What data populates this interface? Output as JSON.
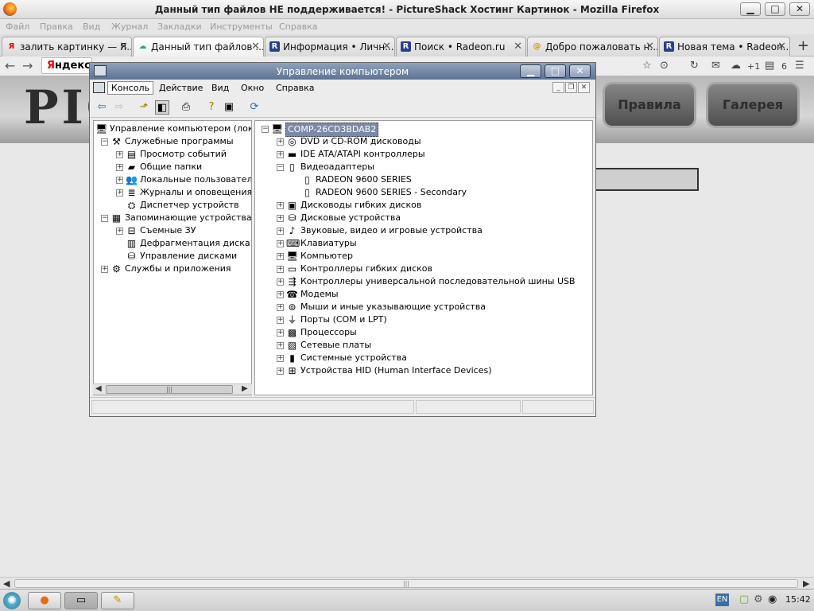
{
  "firefox": {
    "title": "Данный тип файлов НЕ поддерживается! - PictureShack Хостинг Картинок - Mozilla Firefox",
    "window_buttons": {
      "minimize": "▁",
      "maximize": "□",
      "close": "✕"
    },
    "menu": [
      "Файл",
      "Правка",
      "Вид",
      "Журнал",
      "Закладки",
      "Инструменты",
      "Справка"
    ],
    "tabs": [
      {
        "label": "залить картинку — Я...",
        "icon": "yandex-icon",
        "close": "✕"
      },
      {
        "label": "Данный тип файлов ...",
        "icon": "pictureshack-icon",
        "close": "✕",
        "active": true
      },
      {
        "label": "Информация • Личн...",
        "icon": "radeon-icon",
        "close": "✕"
      },
      {
        "label": "Поиск • Radeon.ru",
        "icon": "radeon-icon",
        "close": "✕"
      },
      {
        "label": "Добро пожаловать н...",
        "icon": "mail-icon",
        "close": "✕"
      },
      {
        "label": "Новая тема • Radeon....",
        "icon": "radeon-icon",
        "close": "✕"
      }
    ],
    "new_tab": "+",
    "nav": {
      "back": "←",
      "forward": "→",
      "yandex_y": "Я",
      "yandex_rest": "ндекс",
      "plus_one": "+1",
      "count": "6"
    }
  },
  "site": {
    "logo_text": "PIC",
    "buttons": [
      "Правила",
      "Галерея"
    ]
  },
  "mmc": {
    "title": "Управление компьютером",
    "window_buttons": {
      "minimize": "▁",
      "maximize": "□",
      "close": "✕"
    },
    "menu": [
      "Консоль",
      "Действие",
      "Вид",
      "Окно",
      "Справка"
    ],
    "inner_buttons": {
      "minimize": "_",
      "restore": "❐",
      "close": "✕"
    },
    "toolbar": [
      "back-icon",
      "forward-icon",
      "up-icon",
      "show-tree-icon",
      "print-icon",
      "help-icon",
      "properties-icon",
      "scan-icon"
    ],
    "tree": [
      {
        "label": "Управление компьютером (лока",
        "level": 0,
        "expander": "",
        "icon": "computer-icon"
      },
      {
        "label": "Служебные программы",
        "level": 1,
        "expander": "−",
        "icon": "tools-icon"
      },
      {
        "label": "Просмотр событий",
        "level": 2,
        "expander": "+",
        "icon": "event-icon"
      },
      {
        "label": "Общие папки",
        "level": 2,
        "expander": "+",
        "icon": "folder-icon"
      },
      {
        "label": "Локальные пользователи",
        "level": 2,
        "expander": "+",
        "icon": "users-icon"
      },
      {
        "label": "Журналы и оповещения",
        "level": 2,
        "expander": "+",
        "icon": "log-icon"
      },
      {
        "label": "Диспетчер устройств",
        "level": 2,
        "expander": "",
        "icon": "device-manager-icon"
      },
      {
        "label": "Запоминающие устройства",
        "level": 1,
        "expander": "−",
        "icon": "storage-icon"
      },
      {
        "label": "Съемные ЗУ",
        "level": 2,
        "expander": "+",
        "icon": "removable-icon"
      },
      {
        "label": "Дефрагментация диска",
        "level": 2,
        "expander": "",
        "icon": "defrag-icon"
      },
      {
        "label": "Управление дисками",
        "level": 2,
        "expander": "",
        "icon": "disk-icon"
      },
      {
        "label": "Службы и приложения",
        "level": 1,
        "expander": "+",
        "icon": "services-icon"
      }
    ],
    "devices": [
      {
        "label": "COMP-26CD3BDAB2",
        "level": 0,
        "expander": "−",
        "icon": "computer-icon",
        "selected": true
      },
      {
        "label": "DVD и CD-ROM дисководы",
        "level": 1,
        "expander": "+",
        "icon": "cdrom-icon"
      },
      {
        "label": "IDE ATA/ATAPI контроллеры",
        "level": 1,
        "expander": "+",
        "icon": "ide-icon"
      },
      {
        "label": "Видеоадаптеры",
        "level": 1,
        "expander": "−",
        "icon": "display-icon"
      },
      {
        "label": "RADEON 9600 SERIES",
        "level": 2,
        "expander": "",
        "icon": "display-icon"
      },
      {
        "label": "RADEON 9600 SERIES - Secondary",
        "level": 2,
        "expander": "",
        "icon": "display-icon"
      },
      {
        "label": "Дисководы гибких дисков",
        "level": 1,
        "expander": "+",
        "icon": "floppy-icon"
      },
      {
        "label": "Дисковые устройства",
        "level": 1,
        "expander": "+",
        "icon": "disk-icon"
      },
      {
        "label": "Звуковые, видео и игровые устройства",
        "level": 1,
        "expander": "+",
        "icon": "sound-icon"
      },
      {
        "label": "Клавиатуры",
        "level": 1,
        "expander": "+",
        "icon": "keyboard-icon"
      },
      {
        "label": "Компьютер",
        "level": 1,
        "expander": "+",
        "icon": "computer-icon"
      },
      {
        "label": "Контроллеры гибких дисков",
        "level": 1,
        "expander": "+",
        "icon": "floppy-controller-icon"
      },
      {
        "label": "Контроллеры универсальной последовательной шины USB",
        "level": 1,
        "expander": "+",
        "icon": "usb-icon"
      },
      {
        "label": "Модемы",
        "level": 1,
        "expander": "+",
        "icon": "modem-icon"
      },
      {
        "label": "Мыши и иные указывающие устройства",
        "level": 1,
        "expander": "+",
        "icon": "mouse-icon"
      },
      {
        "label": "Порты (COM и LPT)",
        "level": 1,
        "expander": "+",
        "icon": "port-icon"
      },
      {
        "label": "Процессоры",
        "level": 1,
        "expander": "+",
        "icon": "cpu-icon"
      },
      {
        "label": "Сетевые платы",
        "level": 1,
        "expander": "+",
        "icon": "network-icon"
      },
      {
        "label": "Системные устройства",
        "level": 1,
        "expander": "+",
        "icon": "system-icon"
      },
      {
        "label": "Устройства HID (Human Interface Devices)",
        "level": 1,
        "expander": "+",
        "icon": "hid-icon"
      }
    ]
  },
  "taskbar": {
    "language": "EN",
    "clock": "15:42",
    "tasks": [
      "firefox-icon",
      "mmc-icon",
      "paint-icon"
    ]
  }
}
